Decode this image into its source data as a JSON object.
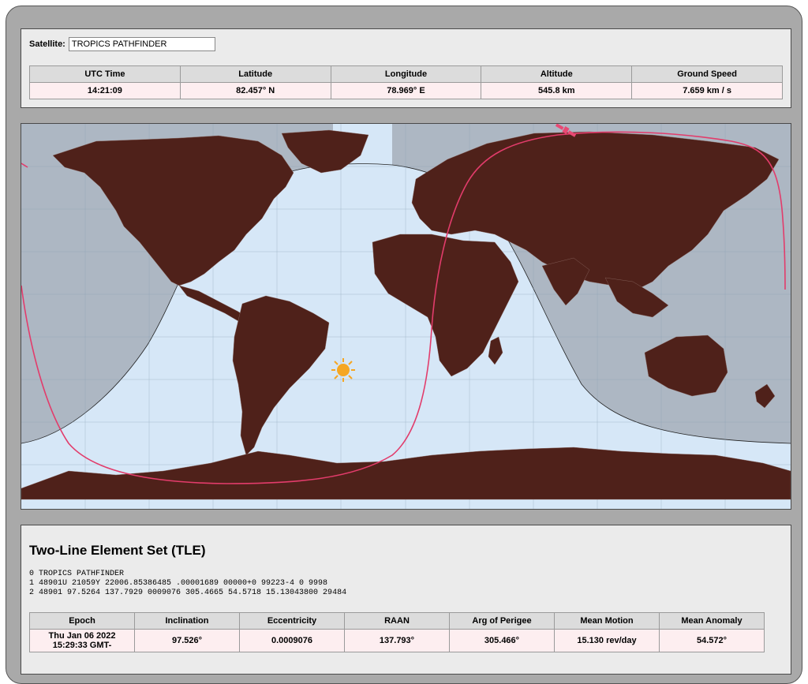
{
  "satellite": {
    "label": "Satellite:",
    "name": "TROPICS PATHFINDER"
  },
  "position": {
    "headers": [
      "UTC Time",
      "Latitude",
      "Longitude",
      "Altitude",
      "Ground Speed"
    ],
    "values": [
      "14:21:09",
      "82.457° N",
      "78.969° E",
      "545.8 km",
      "7.659 km / s"
    ]
  },
  "map": {
    "colors": {
      "ocean": "#d6e7f7",
      "land": "#4f211a",
      "night": "#a9b3be",
      "track": "#e23c6b",
      "sun": "#f5a623",
      "satellite": "#e84a74"
    },
    "icons": {
      "sun": "sun-icon",
      "satellite": "satellite-icon"
    }
  },
  "tle": {
    "title": "Two-Line Element Set (TLE)",
    "line0": "0 TROPICS PATHFINDER",
    "line1": "1 48901U 21059Y 22006.85386485 .00001689 00000+0 99223-4 0 9998",
    "line2": "2 48901 97.5264 137.7929 0009076 305.4665 54.5718 15.13043800 29484"
  },
  "orbit": {
    "headers": [
      "Epoch",
      "Inclination",
      "Eccentricity",
      "RAAN",
      "Arg of Perigee",
      "Mean Motion",
      "Mean Anomaly"
    ],
    "values": [
      "Thu Jan 06 2022 15:29:33 GMT-",
      "97.526°",
      "0.0009076",
      "137.793°",
      "305.466°",
      "15.130 rev/day",
      "54.572°"
    ]
  }
}
